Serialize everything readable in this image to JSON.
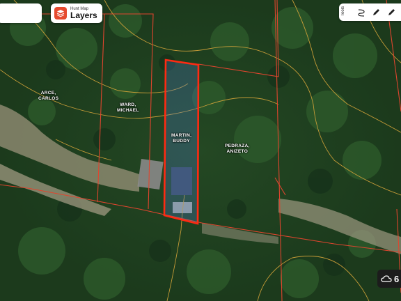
{
  "app": {
    "brand_small": "Hunt Map",
    "layers_label": "Layers"
  },
  "tools": {
    "label": "Tools",
    "icons": [
      "route-icon",
      "pencil-icon",
      "pencil-icon"
    ]
  },
  "parcels": [
    {
      "id": "arce",
      "owner": "ARCE,\nCARLOS"
    },
    {
      "id": "ward",
      "owner": "WARD,\nMICHAEL"
    },
    {
      "id": "martin",
      "owner": "MARTIN,\nBUDDY"
    },
    {
      "id": "pedraza",
      "owner": "PEDRAZA,\nANIZETO"
    }
  ],
  "weather": {
    "icon": "cloud-icon",
    "value": "6"
  },
  "colors": {
    "parcel_line": "#e0452e",
    "selected_parcel": "#ff2a12",
    "contour": "#d8a63a",
    "accent": "#e64a2e"
  }
}
